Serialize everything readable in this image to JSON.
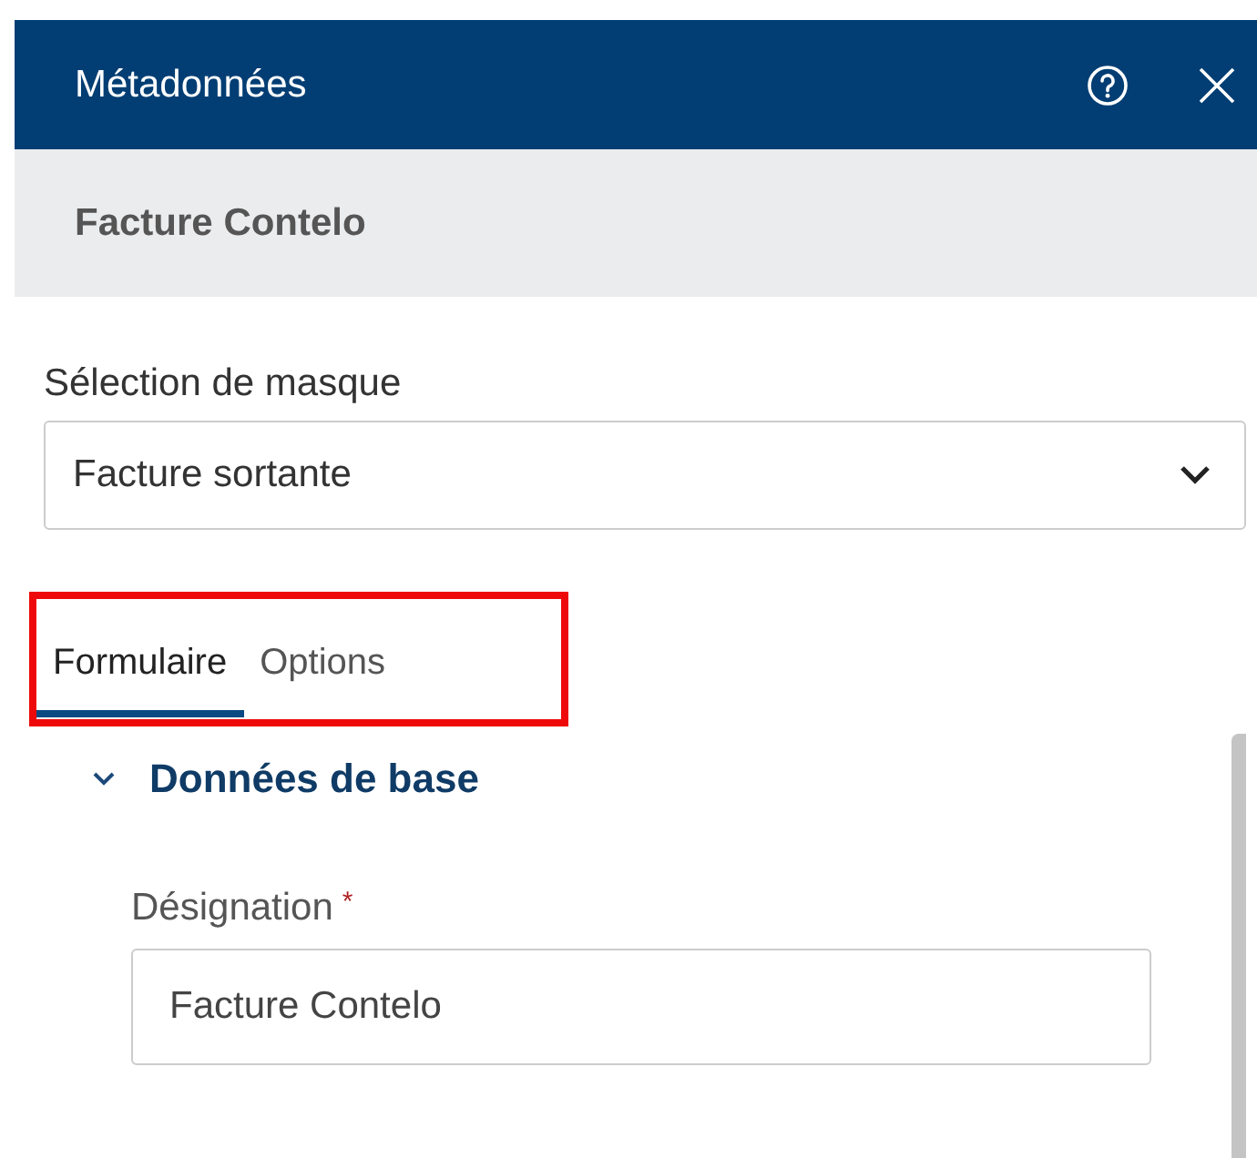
{
  "window": {
    "title": "Métadonnées"
  },
  "subheader": {
    "title": "Facture Contelo"
  },
  "mask_selection": {
    "label": "Sélection de masque",
    "value": "Facture sortante"
  },
  "tabs": [
    {
      "label": "Formulaire",
      "selected": true
    },
    {
      "label": "Options",
      "selected": false
    }
  ],
  "section": {
    "title": "Données de base",
    "expanded": true,
    "fields": [
      {
        "label": "Désignation",
        "required": true,
        "required_mark": "*",
        "value": "Facture Contelo"
      }
    ]
  }
}
